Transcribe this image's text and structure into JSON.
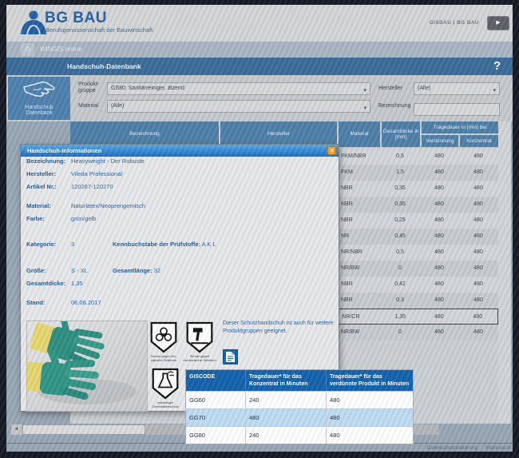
{
  "icons": {
    "play": "▶",
    "home": "⌂",
    "chevron": "▾",
    "close": "×",
    "left_arrow": "◄"
  },
  "header": {
    "brand": "BG BAU",
    "brand_subtitle": "Berufsgenossenschaft der Bauwirtschaft",
    "portal_label": "GISBAU | BG BAU"
  },
  "nav": {
    "breadcrumb": "WINGIS online",
    "page_title": "Handschuh-Datenbank",
    "help": "?"
  },
  "sidebar": {
    "title_line1": "Handschub",
    "title_line2": "Datenbank"
  },
  "filters": {
    "produktgruppe_label_line1": "Produkt-",
    "produktgruppe_label_line2": "gruppe",
    "produktgruppe_value": "GS80: Sanitärreiniger, ätzend",
    "hersteller_label": "Hersteller",
    "hersteller_value": "(Alle)",
    "material_label": "Material",
    "material_value": "(Alle)",
    "bezeichnung_label": "Bezeichnung",
    "bezeichnung_value": ""
  },
  "results_table": {
    "col_bezeichnung": "Bezeichnung",
    "col_hersteller": "Hersteller",
    "col_material": "Material",
    "col_gesamtdicke": "Gesamtdicke in [mm]",
    "col_tragedauer": "Tragedauer in [min] bei",
    "col_verduennung": "Verdünnung",
    "col_konzentrat": "Konzentrat",
    "rows": [
      {
        "material": "FKM/NBR",
        "gesamtdicke": "0,5",
        "verduennung": "480",
        "konzentrat": "480",
        "selected": false
      },
      {
        "material": "FKM",
        "gesamtdicke": "1,5",
        "verduennung": "480",
        "konzentrat": "480",
        "selected": false
      },
      {
        "material": "NBR",
        "gesamtdicke": "0,35",
        "verduennung": "480",
        "konzentrat": "480",
        "selected": false
      },
      {
        "material": "NBR",
        "gesamtdicke": "0,35",
        "verduennung": "480",
        "konzentrat": "480",
        "selected": false
      },
      {
        "material": "NBR",
        "gesamtdicke": "0,25",
        "verduennung": "480",
        "konzentrat": "480",
        "selected": false
      },
      {
        "material": "NR",
        "gesamtdicke": "0,45",
        "verduennung": "480",
        "konzentrat": "480",
        "selected": false
      },
      {
        "material": "NR/NBR",
        "gesamtdicke": "0,5",
        "verduennung": "480",
        "konzentrat": "480",
        "selected": false
      },
      {
        "material": "NR/BW",
        "gesamtdicke": "0",
        "verduennung": "480",
        "konzentrat": "480",
        "selected": false
      },
      {
        "material": "NBR",
        "gesamtdicke": "0,42",
        "verduennung": "480",
        "konzentrat": "480",
        "selected": false
      },
      {
        "material": "NBR",
        "gesamtdicke": "0,3",
        "verduennung": "480",
        "konzentrat": "480",
        "selected": false
      },
      {
        "material": "NR/CR",
        "gesamtdicke": "1,35",
        "verduennung": "480",
        "konzentrat": "480",
        "selected": true
      },
      {
        "material": "NR/BW",
        "gesamtdicke": "0",
        "verduennung": "480",
        "konzentrat": "480",
        "selected": false
      }
    ]
  },
  "modal": {
    "title": "Handschuh-Informationen",
    "bezeichnung_label": "Bezeichnung:",
    "bezeichnung": "Heavyweight - Der Robuste",
    "hersteller_label": "Hersteller:",
    "hersteller": "Vileda Professional",
    "artikel_label": "Artikel Nr.:",
    "artikel": "120267-120270",
    "material_label": "Material:",
    "material": "Naturlatex/Neoprengemisch",
    "farbe_label": "Farbe:",
    "farbe": "grün/gelb",
    "kategorie_label": "Kategorie:",
    "kategorie": "3",
    "kennbuchstabe_label": "Kennbuchstabe der Prüfstoffe:",
    "kennbuchstabe": "A K L",
    "groesse_label": "Größe:",
    "groesse": "S - XL",
    "gesamtlaenge_label": "Gesamtlänge:",
    "gesamtlaenge": "32",
    "gesamtdicke_label": "Gesamtdicke:",
    "gesamtdicke": "1,35",
    "stand_label": "Stand:",
    "stand": "06.06.2017",
    "pictograms": [
      {
        "name": "biohazard-shield",
        "caption": "Schutz gegen bio-logische Gefahren"
      },
      {
        "name": "mechanical-hazard-shield",
        "caption": "Schutz gegen mechanische Gefahren"
      },
      {
        "name": "chemical-protection-shield",
        "caption": "vollwertiger Chemikalienschutz"
      }
    ],
    "note": "Dieser Schutzhandschuh ist auch für weitere Produktgruppen geeignet."
  },
  "giscode_table": {
    "col_giscode": "GISCODE",
    "col_konzentrat": "Tragedauer* für das Konzentrat in Minuten",
    "col_verduennt": "Tragedauer* für das verdünnte Produkt in Minuten",
    "rows": [
      {
        "giscode": "GG60",
        "konzentrat": "240",
        "verduennt": "480",
        "highlighted": false
      },
      {
        "giscode": "GG70",
        "konzentrat": "480",
        "verduennt": "480",
        "highlighted": true
      },
      {
        "giscode": "GG80",
        "konzentrat": "240",
        "verduennt": "480",
        "highlighted": false
      }
    ]
  },
  "footer": {
    "link1": "Datenschutzerklärung",
    "link2": "Impressum"
  }
}
